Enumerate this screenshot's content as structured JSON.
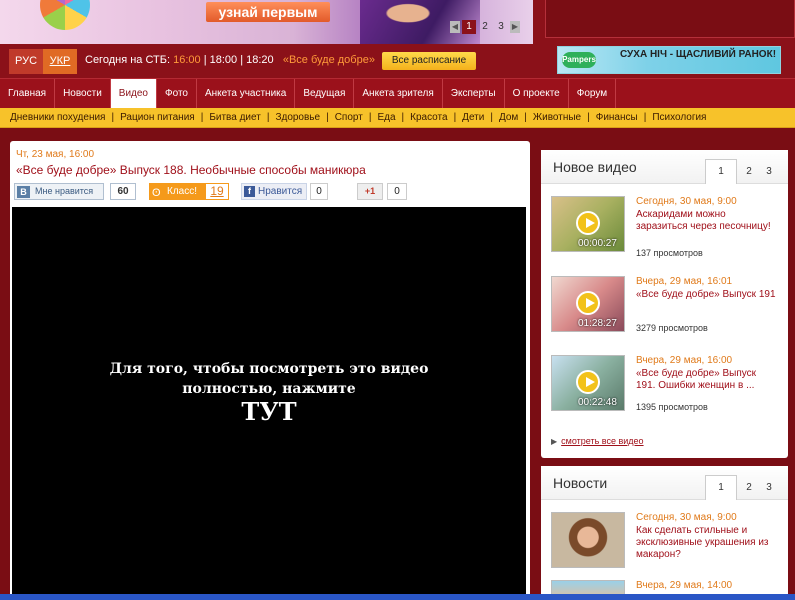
{
  "banner": {
    "cta": "узнай первым",
    "pager": [
      "1",
      "2",
      "3"
    ],
    "pager_prev": "◀",
    "pager_next": "▶"
  },
  "header": {
    "lang_ru": "РУС",
    "lang_ua": "УКР",
    "today_label": "Сегодня на СТБ:",
    "time1": "16:00",
    "sep1": "|",
    "time2": "18:00",
    "sep2": "|",
    "time3": "18:20",
    "show": "«Все буде добре»",
    "schedule_button": "Все расписание",
    "ad_logo": "Pampers",
    "ad_text": "СУХА НІЧ - ЩАСЛИВИЙ РАНОК!"
  },
  "nav": {
    "items": [
      "Главная",
      "Новости",
      "Видео",
      "Фото",
      "Анкета участника",
      "Ведущая",
      "Анкета зрителя",
      "Эксперты",
      "О проекте",
      "Форум"
    ]
  },
  "subnav": {
    "items": [
      "Дневники похудения",
      "Рацион питания",
      "Битва диет",
      "Здоровье",
      "Спорт",
      "Еда",
      "Красота",
      "Дети",
      "Дом",
      "Животные",
      "Финансы",
      "Психология"
    ],
    "separator": "|"
  },
  "article": {
    "date": "Чт, 23 мая, 16:00",
    "title": "«Все буде добре» Выпуск 188. Необычные способы маникюра",
    "vk_logo": "В",
    "vk_label": "Мне нравится",
    "vk_count": "60",
    "ok_icon": "ʘ",
    "ok_label": "Класс!",
    "ok_count": "19",
    "fb_icon": "f",
    "fb_label": "Нравится",
    "fb_count": "0",
    "gp_label": "+1",
    "gp_count": "0",
    "player_line1": "Для того, чтобы посмотреть это видео",
    "player_line2": "полностью, нажмите",
    "player_link": "ТУТ"
  },
  "new_video": {
    "title": "Новое видео",
    "tabs": [
      "1",
      "2",
      "3"
    ],
    "items": [
      {
        "date": "Сегодня, 30 мая, 9:00",
        "title": "Аскаридами можно заразиться через песочницу!",
        "duration": "00:00:27",
        "views": "137 просмотров"
      },
      {
        "date": "Вчера, 29 мая, 16:01",
        "title": "«Все буде добре» Выпуск 191",
        "duration": "01:28:27",
        "views": "3279 просмотров"
      },
      {
        "date": "Вчера, 29 мая, 16:00",
        "title": "«Все буде добре» Выпуск 191. Ошибки женщин в ...",
        "duration": "00:22:48",
        "views": "1395 просмотров"
      }
    ],
    "all_link": "смотреть все видео"
  },
  "news": {
    "title": "Новости",
    "tabs": [
      "1",
      "2",
      "3"
    ],
    "items": [
      {
        "date": "Сегодня, 30 мая, 9:00",
        "title": "Как сделать стильные и эксклюзивные украшения из макарон?"
      },
      {
        "date": "Вчера, 29 мая, 14:00"
      }
    ]
  },
  "colors": {
    "brand": "#8b1119",
    "accent_orange": "#e07a1a",
    "subnav_yellow": "#f7c22a"
  }
}
